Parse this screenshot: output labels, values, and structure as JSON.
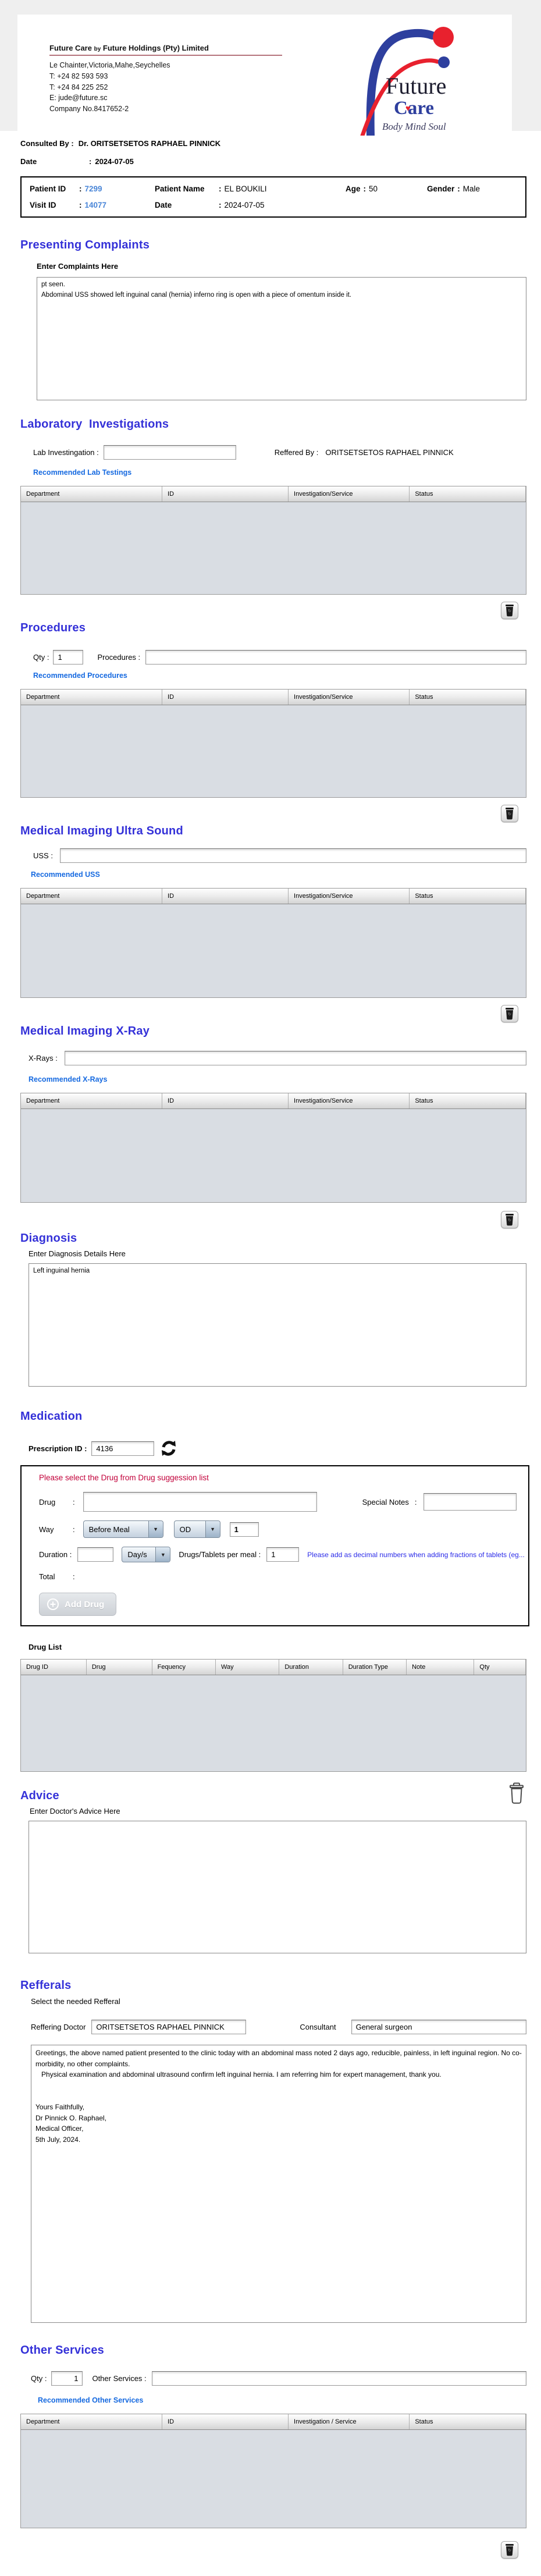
{
  "ui": {
    "colon": ":"
  },
  "icons": {
    "delete": "trash-icon",
    "refresh": "refresh-icon",
    "add": "plus-circle-icon",
    "dropdown": "chevron-down-icon"
  },
  "colors": {
    "heading": "#3431d8",
    "link": "#1569e0",
    "warning": "#c2003a",
    "note": "#2a2ae8",
    "id_blue": "#4a86d8",
    "brand_blue": "#2e3f9e",
    "brand_red": "#e8212e"
  },
  "company": {
    "name_main": "Future Care",
    "name_by": "by",
    "name_rest": "Future Holdings (Pty) Limited",
    "address": "Le Chainter,Victoria,Mahe,Seychelles",
    "phone1": "T: +24  82 593 593",
    "phone2": "T: +24  84 225 252",
    "email": "E: jude@future.sc",
    "company_no": "Company No.8417652-2",
    "logo": {
      "brand_top": "Future",
      "brand_bottom": "Care",
      "heart": "♥",
      "tagline": "Body Mind Soul"
    }
  },
  "consultation": {
    "consulted_by_label": "Consulted By  :",
    "consulted_by": "Dr.  ORITSETSETOS RAPHAEL PINNICK",
    "date_label": "Date",
    "date": "2024-07-05"
  },
  "patient": {
    "patient_id_label": "Patient ID",
    "patient_id": "7299",
    "patient_name_label": "Patient Name",
    "patient_name": "EL BOUKILI",
    "age_label": "Age",
    "age": "50",
    "gender_label": "Gender",
    "gender": "Male",
    "visit_id_label": "Visit ID",
    "visit_id": "14077",
    "visit_date_label": "Date",
    "visit_date": "2024-07-05"
  },
  "presenting_complaints": {
    "title": "Presenting Complaints",
    "label": "Enter Complaints Here",
    "text": "pt seen.\nAbdominal USS showed left inguinal canal (hernia) inferno ring is open with a piece of omentum inside it."
  },
  "laboratory": {
    "title": "Laboratory  Investigations",
    "field_label": "Lab Investingation :",
    "field_value": "",
    "referred_by_label": "Reffered By :",
    "referred_by": "ORITSETSETOS RAPHAEL PINNICK",
    "link": "Recommended Lab Testings",
    "table_columns": [
      "Department",
      "ID",
      "Investigation/Service",
      "Status"
    ]
  },
  "procedures": {
    "title": "Procedures",
    "qty_label": "Qty :",
    "qty": "1",
    "field_label": "Procedures :",
    "field_value": "",
    "link": "Recommended Procedures",
    "table_columns": [
      "Department",
      "ID",
      "Investigation/Service",
      "Status"
    ]
  },
  "uss": {
    "title": "Medical Imaging Ultra Sound",
    "field_label": "USS :",
    "field_value": "",
    "link": "Recommended USS",
    "table_columns": [
      "Department",
      "ID",
      "Investigation/Service",
      "Status"
    ]
  },
  "xray": {
    "title": "Medical Imaging X-Ray",
    "field_label": "X-Rays :",
    "field_value": "",
    "link": "Recommended X-Rays",
    "table_columns": [
      "Department",
      "ID",
      "Investigation/Service",
      "Status"
    ]
  },
  "diagnosis": {
    "title": "Diagnosis",
    "label": "Enter Diagnosis Details Here",
    "text": "Left inguinal hernia"
  },
  "medication": {
    "title": "Medication",
    "prescription_id_label": "Prescription ID :",
    "prescription_id": "4136",
    "warning": "Please select the Drug from Drug suggession list",
    "drug_label": "Drug",
    "drug_value": "",
    "special_notes_label": "Special Notes",
    "special_notes_value": "",
    "way_label": "Way",
    "way_value": "Before Meal",
    "frequency_value": "OD",
    "times_value": "1",
    "duration_label": "Duration :",
    "duration_value": "",
    "duration_unit": "Day/s",
    "per_meal_label": "Drugs/Tablets per meal :",
    "per_meal_value": "1",
    "note": "Please add as decimal numbers when adding fractions of tablets (eg...",
    "total_label": "Total",
    "add_drug_label": "Add Drug",
    "drug_list_label": "Drug List",
    "table_columns": [
      "Drug ID",
      "Drug",
      "Fequency",
      "Way",
      "Duration",
      "Duration Type",
      "Note",
      "Qty"
    ]
  },
  "advice": {
    "title": "Advice",
    "label": "Enter Doctor's Advice Here",
    "text": ""
  },
  "referrals": {
    "title": "Refferals",
    "label": "Select the needed Refferal",
    "doctor_label": "Reffering Doctor",
    "doctor": "ORITSETSETOS RAPHAEL PINNICK",
    "consultant_label": "Consultant",
    "consultant": "General surgeon",
    "letter": "Greetings, the above named patient presented to the clinic today with an abdominal mass noted 2 days ago, reducible, painless, in left inguinal region. No co-morbidity, no other complaints.\n   Physical examination and abdominal ultrasound confirm left inguinal hernia. I am referring him for expert management, thank you.\n\n\nYours Faithfully,\nDr Pinnick O. Raphael,\nMedical Officer,\n5th July, 2024."
  },
  "other_services": {
    "title": "Other Services",
    "qty_label": "Qty :",
    "qty": "1",
    "field_label": "Other Services :",
    "field_value": "",
    "link": "Recommended Other Services",
    "table_columns": [
      "Department",
      "ID",
      "Investigation / Service",
      "Status"
    ]
  }
}
